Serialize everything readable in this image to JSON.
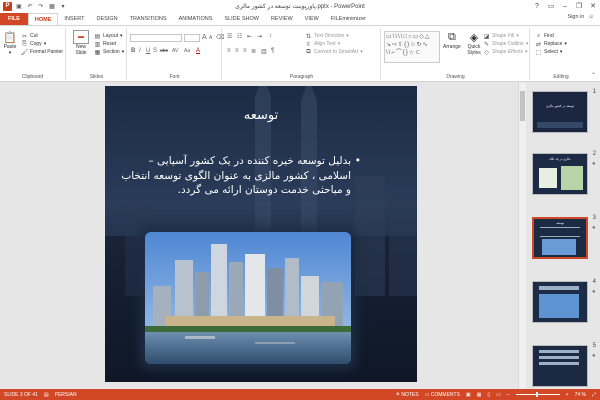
{
  "window": {
    "title": "پاورپوینت توسعه در کشور مالزی.pptx - PowerPoint",
    "minimize": "–",
    "restore": "❐",
    "close": "✕",
    "help": "?",
    "ribbon_display": "▭"
  },
  "tabs": [
    "FILE",
    "HOME",
    "INSERT",
    "DESIGN",
    "TRANSITIONS",
    "ANIMATIONS",
    "SLIDE SHOW",
    "REVIEW",
    "VIEW",
    "FILEminimizer"
  ],
  "active_tab": "HOME",
  "signin": "Sign in",
  "ribbon": {
    "clipboard": {
      "label": "Clipboard",
      "paste": "Paste",
      "cut": "Cut",
      "copy": "Copy",
      "format_painter": "Format Painter"
    },
    "slides": {
      "label": "Slides",
      "new_slide": "New Slide",
      "layout": "Layout",
      "reset": "Reset",
      "section": "Section"
    },
    "font": {
      "label": "Font",
      "bold": "B",
      "italic": "I",
      "underline": "U",
      "shadow": "S",
      "strike": "abc",
      "spacing": "AV",
      "case": "Aa",
      "grow": "A",
      "shrink": "A"
    },
    "paragraph": {
      "label": "Paragraph",
      "text_direction": "Text Direction",
      "align_text": "Align Text",
      "convert_smartart": "Convert to SmartArt"
    },
    "drawing": {
      "label": "Drawing",
      "arrange": "Arrange",
      "quick_styles": "Quick Styles",
      "shape_fill": "Shape Fill",
      "shape_outline": "Shape Outline",
      "shape_effects": "Shape Effects"
    },
    "editing": {
      "label": "Editing",
      "find": "Find",
      "replace": "Replace",
      "select": "Select"
    }
  },
  "slide": {
    "title": "توسعه",
    "body": "بدلیل توسعه خیره کننده در یک کشور آسیایی – اسلامی ، کشور مالزی به عنوان الگوی توسعه انتخاب و مباحثی خدمت دوستان ارائه می گردد.",
    "bullet": "•"
  },
  "thumbnails": [
    {
      "num": "1",
      "caption": "توسعه در کشور مالزی",
      "star": ""
    },
    {
      "num": "2",
      "caption": "مالزی در یک نگاه",
      "star": "★"
    },
    {
      "num": "3",
      "caption": "توسعه",
      "star": "★",
      "selected": true
    },
    {
      "num": "4",
      "caption": "",
      "star": "★"
    },
    {
      "num": "5",
      "caption": "",
      "star": "★"
    }
  ],
  "status": {
    "slide": "SLIDE 3 OF 41",
    "language": "PERSIAN",
    "notes": "NOTES",
    "comments": "COMMENTS",
    "zoom": "74 %",
    "zoom_minus": "–",
    "zoom_plus": "+",
    "fit": "⤢"
  },
  "colors": {
    "accent": "#d24726",
    "slide_bg": "#1c2b44"
  }
}
